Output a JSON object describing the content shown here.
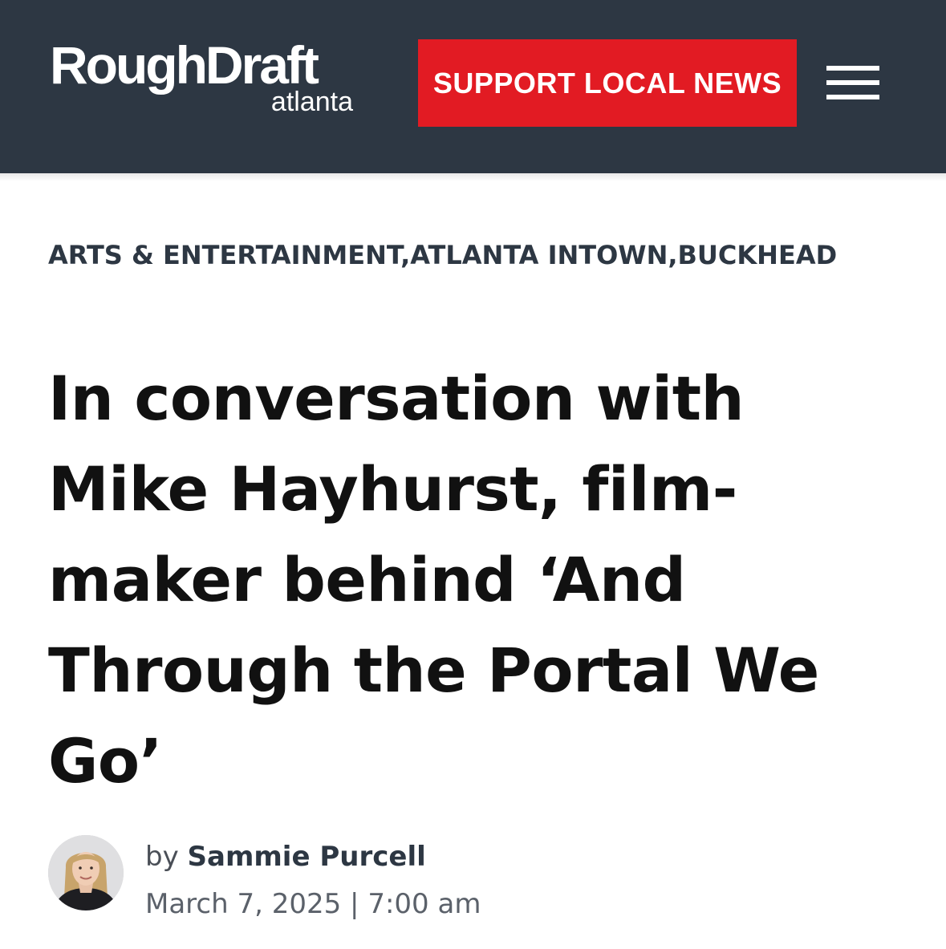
{
  "header": {
    "logo_main": "RoughDraft",
    "logo_sub": "atlanta",
    "support_label": "SUPPORT LOCAL NEWS",
    "menu_icon": "hamburger-menu-icon",
    "colors": {
      "background": "#2d3743",
      "support_button": "#e21b23"
    }
  },
  "article": {
    "categories": [
      "ARTS & ENTERTAINMENT",
      "ATLANTA INTOWN",
      "BUCKHEAD"
    ],
    "category_separator": ",",
    "title": "In conversation with Mike Hayhurst, film-maker behind ‘And Through the Portal We Go’",
    "byline_prefix": "by",
    "author": "Sammie Purcell",
    "date": "March 7, 2025",
    "date_separator": "|",
    "time": "7:00 am"
  }
}
